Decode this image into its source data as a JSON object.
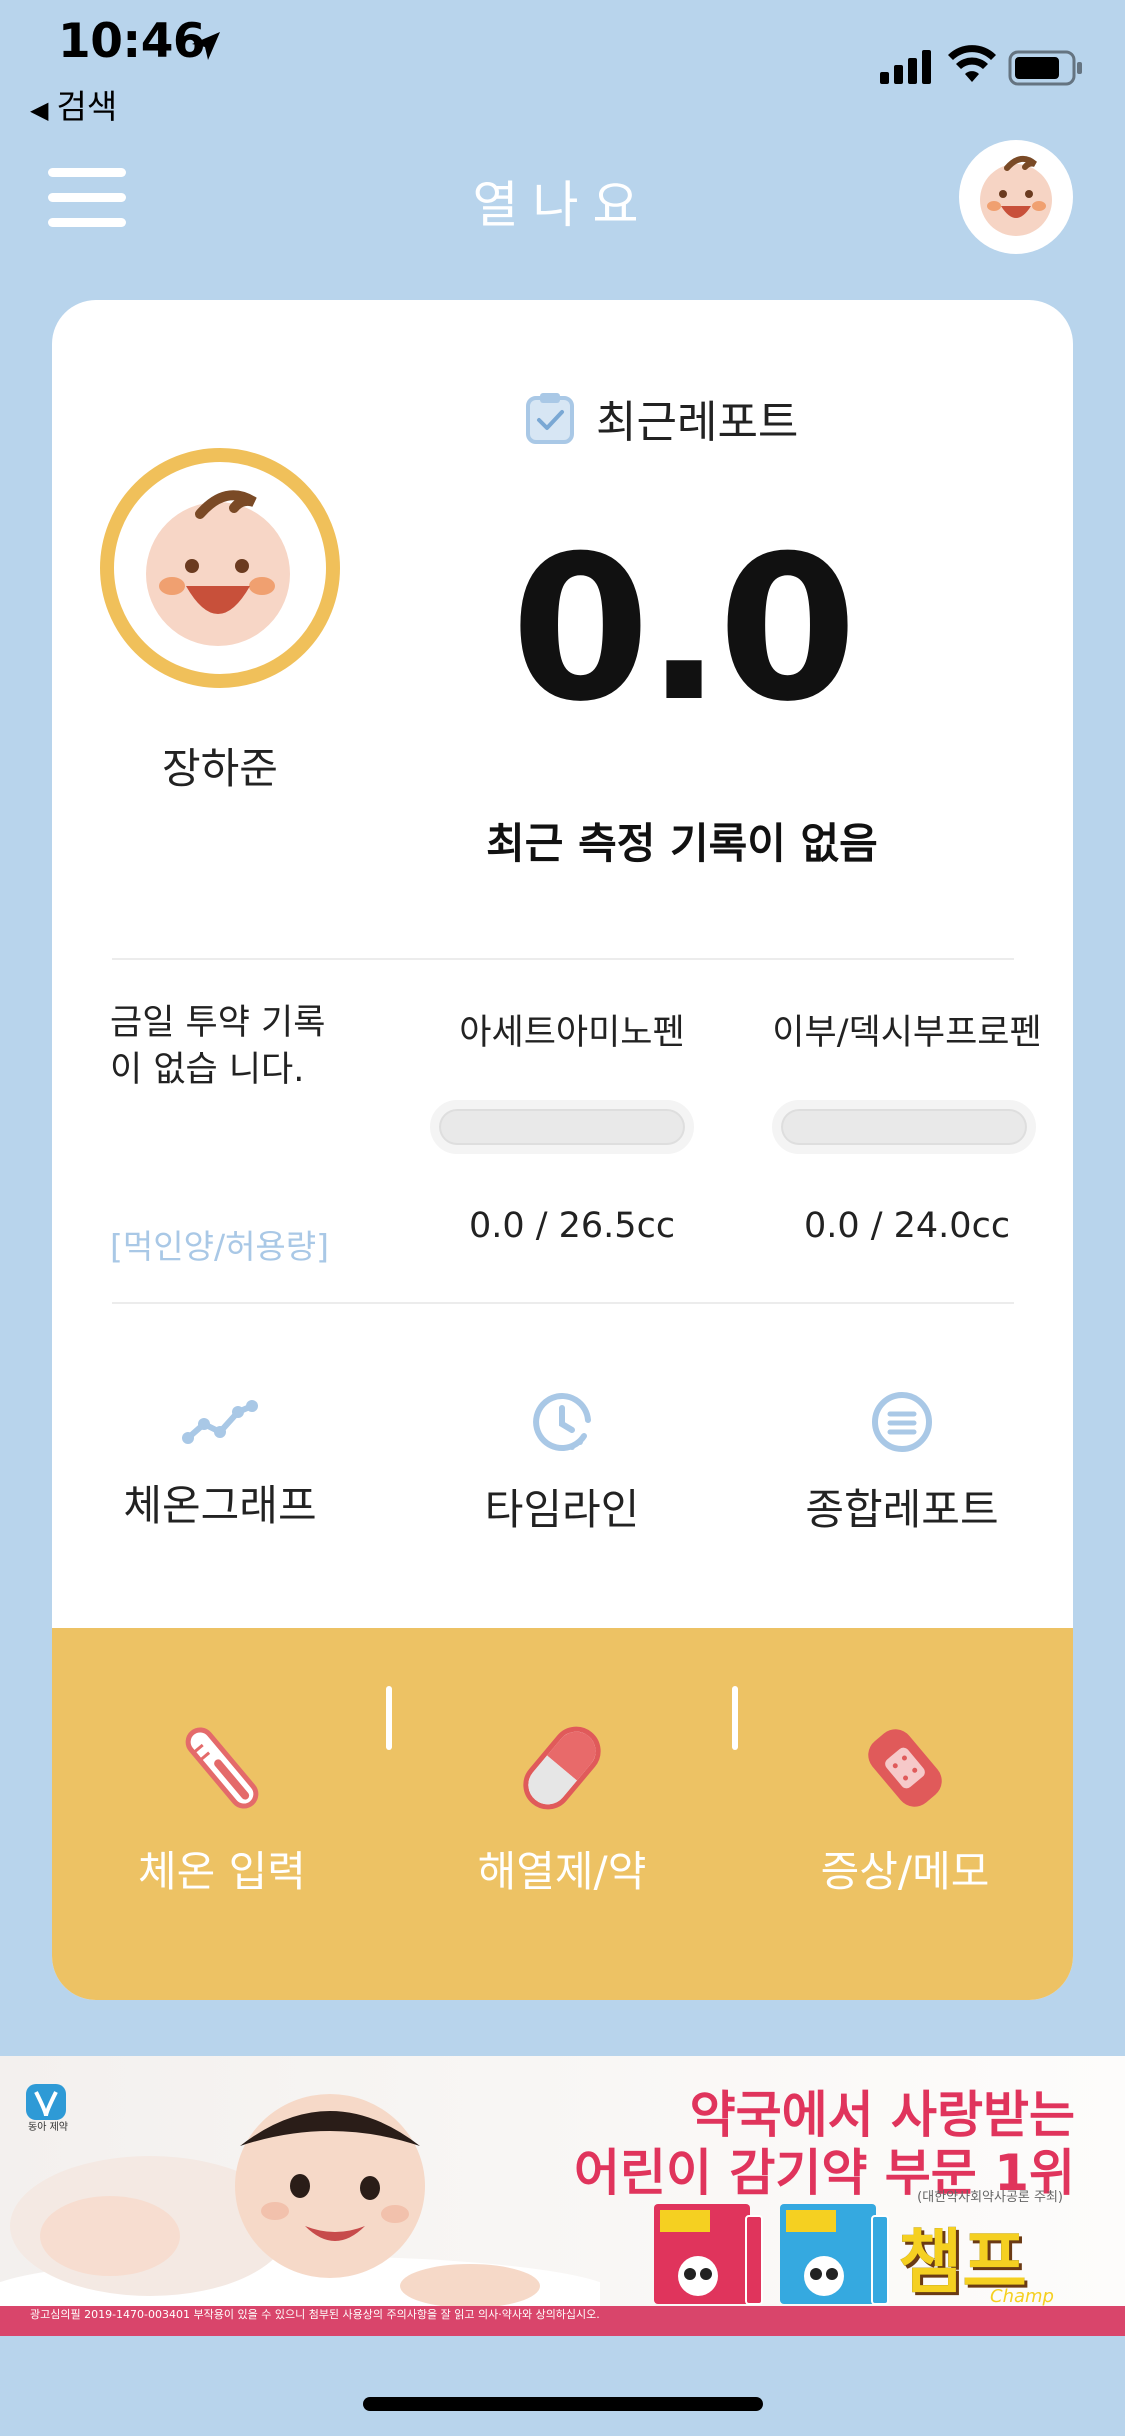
{
  "status_bar": {
    "time": "10:46",
    "back_label": "검색"
  },
  "header": {
    "title": "열나요"
  },
  "profile": {
    "name": "장하준"
  },
  "report": {
    "label": "최근레포트",
    "temperature": "0.0",
    "status": "최근 측정 기록이 없음"
  },
  "medication": {
    "note": "금일 투약 기록이 없습 니다.",
    "ratio_label": "[먹인양/허용량]",
    "drugs": [
      {
        "name": "아세트아미노펜",
        "dose": "0.0 / 26.5cc",
        "fill": 0
      },
      {
        "name": "이부/덱시부프로펜",
        "dose": "0.0 / 24.0cc",
        "fill": 0
      }
    ]
  },
  "nav": [
    {
      "label": "체온그래프",
      "icon": "graph-icon"
    },
    {
      "label": "타임라인",
      "icon": "clock-icon"
    },
    {
      "label": "종합레포트",
      "icon": "list-icon"
    }
  ],
  "actions": [
    {
      "label": "체온 입력",
      "icon": "thermometer-icon"
    },
    {
      "label": "해열제/약",
      "icon": "pill-icon"
    },
    {
      "label": "증상/메모",
      "icon": "bandage-icon"
    }
  ],
  "ad": {
    "logo_text": "동아 제약",
    "headline_1": "약국에서 사랑받는",
    "headline_2": "어린이 감기약 부문 1위",
    "sub": "(대한약사회약사공론 주최)",
    "brand": "챔프",
    "brand_en": "Champ",
    "footer": "광고심의필 2019-1470-003401   부작용이 있을 수 있으니 첨부된 사용상의 주의사항을 잘 읽고 의사·약사와 상의하십시오."
  },
  "colors": {
    "background": "#b8d4ec",
    "panel": "#edc264",
    "accent_ring": "#f0c05a",
    "ad_red": "#e0345c"
  }
}
